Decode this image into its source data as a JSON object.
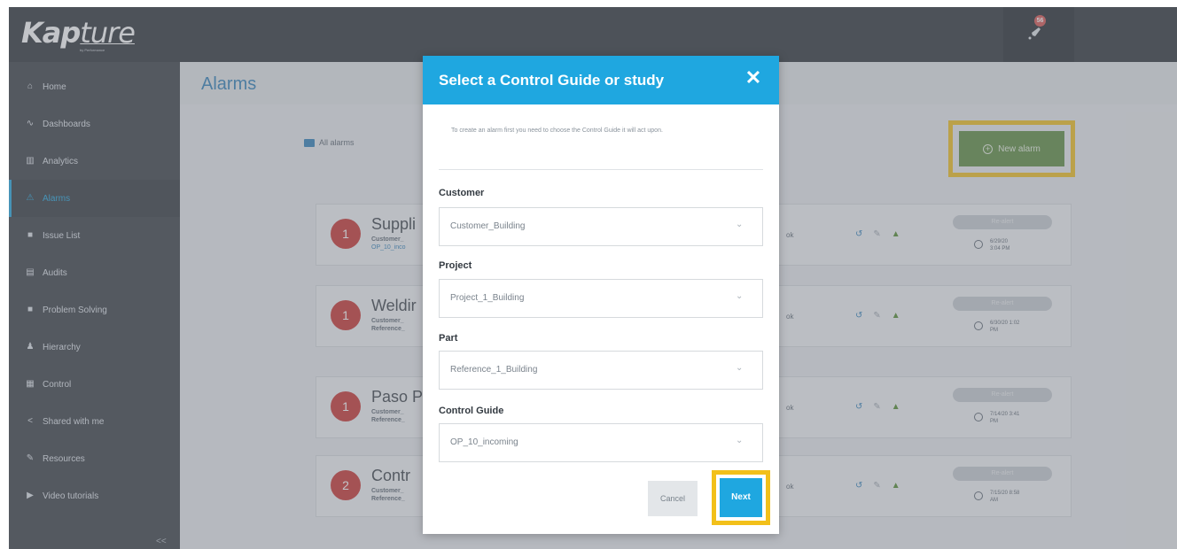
{
  "brand": {
    "logo_main": "Kap",
    "logo_thin": "ture",
    "logo_sub": "by Performance"
  },
  "topbar": {
    "notification_count": "56"
  },
  "sidebar": {
    "items": [
      {
        "label": "Home",
        "icon": "home-icon",
        "glyph": "⌂"
      },
      {
        "label": "Dashboards",
        "icon": "line-chart-icon",
        "glyph": "∿"
      },
      {
        "label": "Analytics",
        "icon": "bar-chart-icon",
        "glyph": "▥"
      },
      {
        "label": "Alarms",
        "icon": "warning-icon",
        "glyph": "⚠"
      },
      {
        "label": "Issue List",
        "icon": "issue-icon",
        "glyph": "■"
      },
      {
        "label": "Audits",
        "icon": "audit-icon",
        "glyph": "▤"
      },
      {
        "label": "Problem Solving",
        "icon": "problem-icon",
        "glyph": "■"
      },
      {
        "label": "Hierarchy",
        "icon": "hierarchy-icon",
        "glyph": "♟"
      },
      {
        "label": "Control",
        "icon": "control-icon",
        "glyph": "▦"
      },
      {
        "label": "Shared with me",
        "icon": "share-icon",
        "glyph": "<"
      },
      {
        "label": "Resources",
        "icon": "resources-icon",
        "glyph": "✎"
      },
      {
        "label": "Video tutorials",
        "icon": "video-icon",
        "glyph": "▶"
      }
    ],
    "collapse_label": "<<"
  },
  "main": {
    "title": "Alarms",
    "breadcrumb": "All alarms",
    "new_alarm_label": "New alarm"
  },
  "cards": [
    {
      "num": "1",
      "title": "Suppli",
      "sub1": "Customer_",
      "sub2": "OP_10_inco",
      "ok": "ok",
      "realert": "Re-alert",
      "time1": "6/29/20",
      "time2": "3:04 PM"
    },
    {
      "num": "1",
      "title": "Weldir",
      "sub1": "Customer_",
      "sub2": "Reference_",
      "ok": "ok",
      "realert": "Re-alert",
      "time1": "6/30/20 1:02",
      "time2": "PM"
    },
    {
      "num": "1",
      "title": "Paso P",
      "sub1": "Customer_",
      "sub2": "Reference_",
      "ok": "ok",
      "realert": "Re-alert",
      "time1": "7/14/20 3:41",
      "time2": "PM"
    },
    {
      "num": "2",
      "title": "Contr",
      "sub1": "Customer_",
      "sub2": "Reference_",
      "ok": "ok",
      "realert": "Re-alert",
      "time1": "7/15/20 8:58",
      "time2": "AM"
    }
  ],
  "modal": {
    "title": "Select a Control Guide or study",
    "close": "✕",
    "description": "To create an alarm first you need to choose the Control Guide it will act upon.",
    "fields": [
      {
        "label": "Customer",
        "value": "Customer_Building"
      },
      {
        "label": "Project",
        "value": "Project_1_Building"
      },
      {
        "label": "Part",
        "value": "Reference_1_Building"
      },
      {
        "label": "Control Guide",
        "value": "OP_10_incoming"
      }
    ],
    "cancel_label": "Cancel",
    "next_label": "Next"
  }
}
